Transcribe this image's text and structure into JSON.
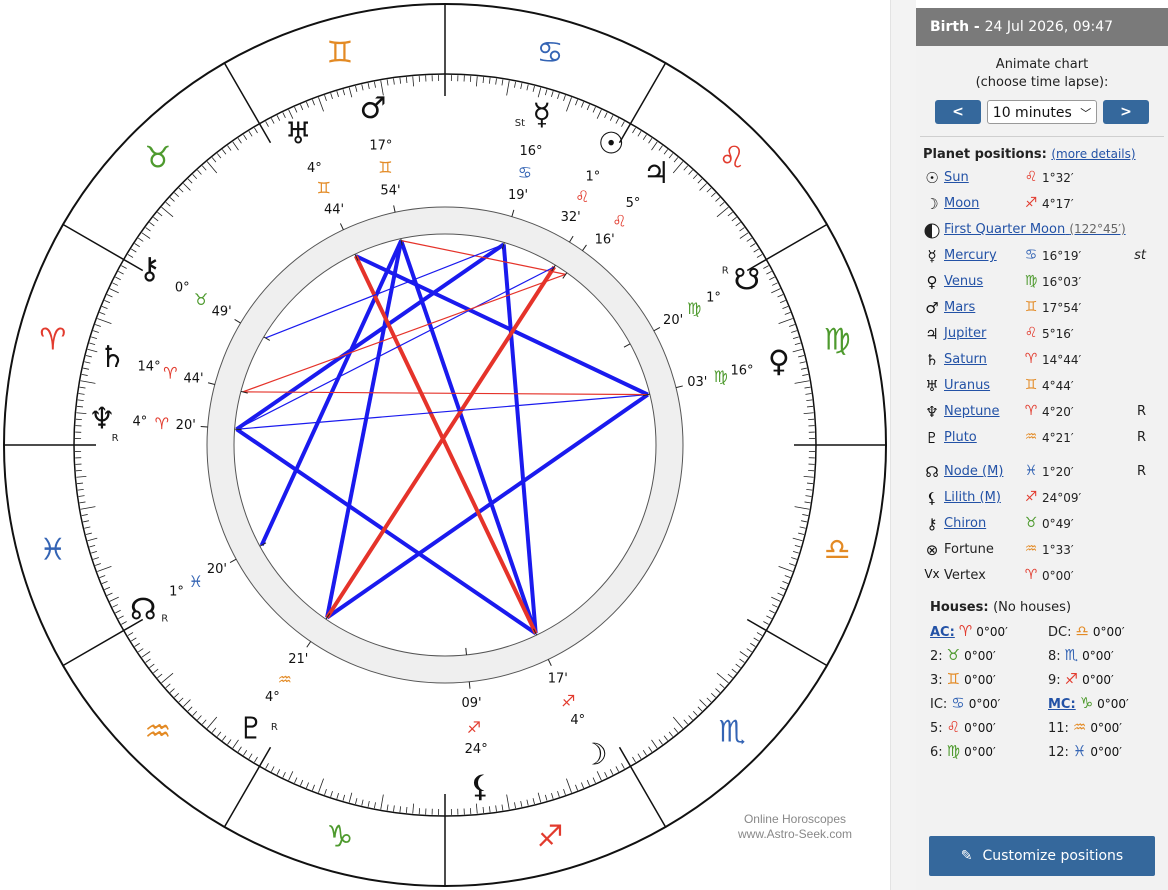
{
  "chart_wheel": {
    "zodiac": [
      {
        "name": "aries",
        "glyph": "♈",
        "color": "#e23b2e"
      },
      {
        "name": "taurus",
        "glyph": "♉",
        "color": "#4e9a2e"
      },
      {
        "name": "gemini",
        "glyph": "♊",
        "color": "#e38a24"
      },
      {
        "name": "cancer",
        "glyph": "♋",
        "color": "#3464b4"
      },
      {
        "name": "leo",
        "glyph": "♌",
        "color": "#e23b2e"
      },
      {
        "name": "virgo",
        "glyph": "♍",
        "color": "#4e9a2e"
      },
      {
        "name": "libra",
        "glyph": "♎",
        "color": "#e38a24"
      },
      {
        "name": "scorpio",
        "glyph": "♏",
        "color": "#3464b4"
      },
      {
        "name": "sagittarius",
        "glyph": "♐",
        "color": "#e23b2e"
      },
      {
        "name": "capricorn",
        "glyph": "♑",
        "color": "#4e9a2e"
      },
      {
        "name": "aquarius",
        "glyph": "♒",
        "color": "#e38a24"
      },
      {
        "name": "pisces",
        "glyph": "♓",
        "color": "#3464b4"
      }
    ],
    "planets": [
      {
        "name": "sun",
        "glyph": "☉",
        "lon": 121.53,
        "deg": "1°",
        "sign": "♌",
        "sign_color": "#e23b2e",
        "min": "32'",
        "retro": ""
      },
      {
        "name": "moon",
        "glyph": "☽",
        "lon": 244.28,
        "deg": "4°",
        "sign": "♐",
        "sign_color": "#e23b2e",
        "min": "17'",
        "retro": ""
      },
      {
        "name": "mercury",
        "glyph": "☿",
        "lon": 106.32,
        "deg": "16°",
        "sign": "♋",
        "sign_color": "#3464b4",
        "min": "19'",
        "retro": "St"
      },
      {
        "name": "venus",
        "glyph": "♀",
        "lon": 166.05,
        "deg": "16°",
        "sign": "♍",
        "sign_color": "#4e9a2e",
        "min": "03'",
        "retro": ""
      },
      {
        "name": "mars",
        "glyph": "♂",
        "lon": 77.9,
        "deg": "17°",
        "sign": "♊",
        "sign_color": "#e38a24",
        "min": "54'",
        "retro": ""
      },
      {
        "name": "jupiter",
        "glyph": "♃",
        "lon": 125.27,
        "deg": "5°",
        "sign": "♌",
        "sign_color": "#e23b2e",
        "min": "16'",
        "retro": ""
      },
      {
        "name": "saturn",
        "glyph": "♄",
        "lon": 14.73,
        "deg": "14°",
        "sign": "♈",
        "sign_color": "#e23b2e",
        "min": "44'",
        "retro": ""
      },
      {
        "name": "uranus",
        "glyph": "♅",
        "lon": 64.73,
        "deg": "4°",
        "sign": "♊",
        "sign_color": "#e38a24",
        "min": "44'",
        "retro": ""
      },
      {
        "name": "neptune",
        "glyph": "♆",
        "lon": 4.33,
        "deg": "4°",
        "sign": "♈",
        "sign_color": "#e23b2e",
        "min": "20'",
        "retro": "R"
      },
      {
        "name": "pluto",
        "glyph": "♇",
        "lon": 304.35,
        "deg": "4°",
        "sign": "♒",
        "sign_color": "#e38a24",
        "min": "21'",
        "retro": "R"
      },
      {
        "name": "node",
        "glyph": "☊",
        "lon": 331.33,
        "deg": "1°",
        "sign": "♓",
        "sign_color": "#3464b4",
        "min": "20'",
        "retro": "R"
      },
      {
        "name": "lilith",
        "glyph": "⚸",
        "lon": 264.15,
        "deg": "24°",
        "sign": "♐",
        "sign_color": "#e23b2e",
        "min": "09'",
        "retro": ""
      },
      {
        "name": "chiron",
        "glyph": "⚷",
        "lon": 30.82,
        "deg": "0°",
        "sign": "♉",
        "sign_color": "#4e9a2e",
        "min": "49'",
        "retro": ""
      },
      {
        "name": "south-node",
        "glyph": "☋",
        "lon": 151.33,
        "deg": "1°",
        "sign": "♍",
        "sign_color": "#4e9a2e",
        "min": "20'",
        "retro": "R"
      }
    ],
    "aspects": [
      {
        "from": "venus",
        "to": "uranus",
        "color": "#1a1aee",
        "weight": "major"
      },
      {
        "from": "venus",
        "to": "pluto",
        "color": "#1a1aee",
        "weight": "major"
      },
      {
        "from": "pluto",
        "to": "mars",
        "color": "#1a1aee",
        "weight": "major"
      },
      {
        "from": "mars",
        "to": "moon",
        "color": "#1a1aee",
        "weight": "major"
      },
      {
        "from": "moon",
        "to": "mercury",
        "color": "#1a1aee",
        "weight": "major"
      },
      {
        "from": "mercury",
        "to": "neptune",
        "color": "#1a1aee",
        "weight": "major"
      },
      {
        "from": "neptune",
        "to": "moon",
        "color": "#1a1aee",
        "weight": "major"
      },
      {
        "from": "mars",
        "to": "node",
        "color": "#1a1aee",
        "weight": "major"
      },
      {
        "from": "pluto",
        "to": "sun",
        "color": "#e5332a",
        "weight": "major"
      },
      {
        "from": "moon",
        "to": "uranus",
        "color": "#e5332a",
        "weight": "major"
      },
      {
        "from": "mars",
        "to": "jupiter",
        "color": "#e5332a",
        "weight": "minor"
      },
      {
        "from": "neptune",
        "to": "venus",
        "color": "#1a1aee",
        "weight": "minor"
      },
      {
        "from": "neptune",
        "to": "sun",
        "color": "#1a1aee",
        "weight": "minor"
      },
      {
        "from": "saturn",
        "to": "jupiter",
        "color": "#e5332a",
        "weight": "minor"
      },
      {
        "from": "saturn",
        "to": "venus",
        "color": "#e5332a",
        "weight": "minor"
      },
      {
        "from": "chiron",
        "to": "mercury",
        "color": "#1a1aee",
        "weight": "minor"
      }
    ],
    "watermark": [
      "Online Horoscopes",
      "www.Astro-Seek.com"
    ]
  },
  "panel": {
    "header_bold": "Birth - ",
    "header_date": "24 Jul 2026, 09:47",
    "animate_line1": "Animate chart",
    "animate_line2": "(choose time lapse):",
    "prev_label": "<",
    "next_label": ">",
    "time_lapse": "10 minutes",
    "positions_title": "Planet positions:",
    "more_details": "(more details)",
    "planets": [
      {
        "glyph": "☉",
        "name": "Sun",
        "sign": "♌",
        "color": "#e23b2e",
        "value": "1°32′",
        "flag": ""
      },
      {
        "glyph": "☽",
        "name": "Moon",
        "sign": "♐",
        "color": "#e23b2e",
        "value": "4°17′",
        "flag": ""
      }
    ],
    "moon_phase": {
      "name": "First Quarter Moon",
      "extra": "(122°45′)"
    },
    "planets2": [
      {
        "glyph": "☿",
        "name": "Mercury",
        "sign": "♋",
        "color": "#3464b4",
        "value": "16°19′",
        "flag": "st"
      },
      {
        "glyph": "♀",
        "name": "Venus",
        "sign": "♍",
        "color": "#4e9a2e",
        "value": "16°03′",
        "flag": ""
      },
      {
        "glyph": "♂",
        "name": "Mars",
        "sign": "♊",
        "color": "#e38a24",
        "value": "17°54′",
        "flag": ""
      },
      {
        "glyph": "♃",
        "name": "Jupiter",
        "sign": "♌",
        "color": "#e23b2e",
        "value": "5°16′",
        "flag": ""
      },
      {
        "glyph": "♄",
        "name": "Saturn",
        "sign": "♈",
        "color": "#e23b2e",
        "value": "14°44′",
        "flag": ""
      },
      {
        "glyph": "♅",
        "name": "Uranus",
        "sign": "♊",
        "color": "#e38a24",
        "value": "4°44′",
        "flag": ""
      },
      {
        "glyph": "♆",
        "name": "Neptune",
        "sign": "♈",
        "color": "#e23b2e",
        "value": "4°20′",
        "flag": "R"
      },
      {
        "glyph": "♇",
        "name": "Pluto",
        "sign": "♒",
        "color": "#e38a24",
        "value": "4°21′",
        "flag": "R"
      }
    ],
    "points": [
      {
        "glyph": "☊",
        "name": "Node (M)",
        "sign": "♓",
        "color": "#3464b4",
        "value": "1°20′",
        "flag": "R",
        "link": true
      },
      {
        "glyph": "⚸",
        "name": "Lilith (M)",
        "sign": "♐",
        "color": "#e23b2e",
        "value": "24°09′",
        "flag": "",
        "link": true
      },
      {
        "glyph": "⚷",
        "name": "Chiron",
        "sign": "♉",
        "color": "#4e9a2e",
        "value": "0°49′",
        "flag": "",
        "link": true
      },
      {
        "glyph": "⊗",
        "name": "Fortune",
        "sign": "♒",
        "color": "#e38a24",
        "value": "1°33′",
        "flag": "",
        "link": false
      },
      {
        "glyph": "Vx",
        "name": "Vertex",
        "sign": "♈",
        "color": "#e23b2e",
        "value": "0°00′",
        "flag": "",
        "link": false
      }
    ],
    "houses_title": "Houses:",
    "houses_note": "(No houses)",
    "houses": [
      {
        "label": "AC:",
        "sign": "♈",
        "color": "#e23b2e",
        "value": "0°00′",
        "link": true
      },
      {
        "label": "DC:",
        "sign": "♎",
        "color": "#e38a24",
        "value": "0°00′",
        "link": false
      },
      {
        "label": "2:",
        "sign": "♉",
        "color": "#4e9a2e",
        "value": "0°00′",
        "link": false
      },
      {
        "label": "8:",
        "sign": "♏",
        "color": "#3464b4",
        "value": "0°00′",
        "link": false
      },
      {
        "label": "3:",
        "sign": "♊",
        "color": "#e38a24",
        "value": "0°00′",
        "link": false
      },
      {
        "label": "9:",
        "sign": "♐",
        "color": "#e23b2e",
        "value": "0°00′",
        "link": false
      },
      {
        "label": "IC:",
        "sign": "♋",
        "color": "#3464b4",
        "value": "0°00′",
        "link": false
      },
      {
        "label": "MC:",
        "sign": "♑",
        "color": "#4e9a2e",
        "value": "0°00′",
        "link": true
      },
      {
        "label": "5:",
        "sign": "♌",
        "color": "#e23b2e",
        "value": "0°00′",
        "link": false
      },
      {
        "label": "11:",
        "sign": "♒",
        "color": "#e38a24",
        "value": "0°00′",
        "link": false
      },
      {
        "label": "6:",
        "sign": "♍",
        "color": "#4e9a2e",
        "value": "0°00′",
        "link": false
      },
      {
        "label": "12:",
        "sign": "♓",
        "color": "#3464b4",
        "value": "0°00′",
        "link": false
      }
    ],
    "customize_label": "Customize positions"
  }
}
